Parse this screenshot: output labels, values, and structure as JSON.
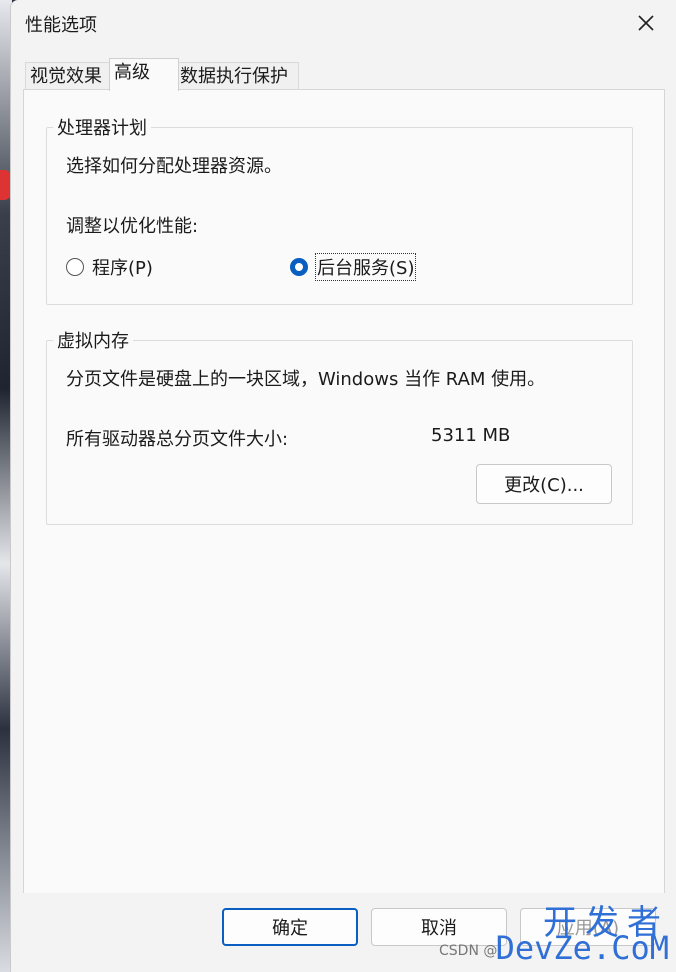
{
  "window": {
    "title": "性能选项"
  },
  "tabs": [
    {
      "label": "视觉效果"
    },
    {
      "label": "高级"
    },
    {
      "label": "数据执行保护"
    }
  ],
  "processor": {
    "legend": "处理器计划",
    "description": "选择如何分配处理器资源。",
    "adjust_label": "调整以优化性能:",
    "options": [
      {
        "label": "程序(P)",
        "selected": false
      },
      {
        "label": "后台服务(S)",
        "selected": true
      }
    ]
  },
  "virtual_memory": {
    "legend": "虚拟内存",
    "description": "分页文件是硬盘上的一块区域，Windows 当作 RAM 使用。",
    "total_label": "所有驱动器总分页文件大小:",
    "total_value": "5311 MB",
    "change_button": "更改(C)..."
  },
  "footer": {
    "ok": "确定",
    "cancel": "取消",
    "apply": "应用(A)"
  },
  "watermark": {
    "top": "开发者",
    "csdn": "CSDN @",
    "site": "DevZe.CoM"
  },
  "colors": {
    "accent": "#0a5ec2"
  }
}
